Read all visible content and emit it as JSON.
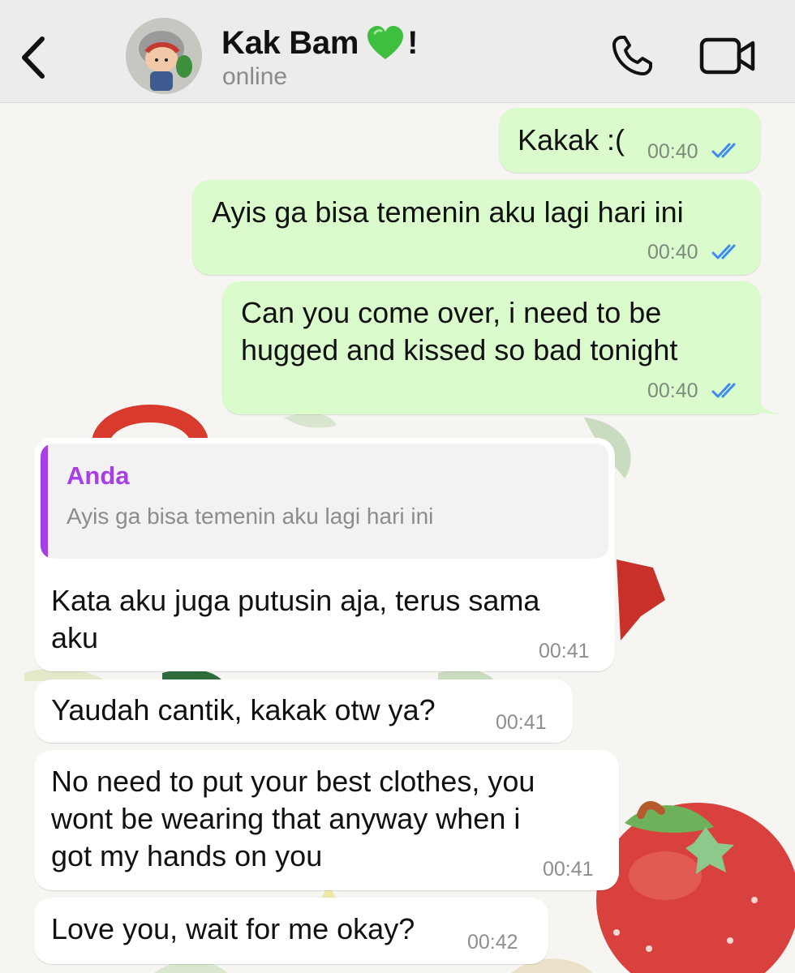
{
  "header": {
    "contact_name": "Kak Bam",
    "contact_name_suffix": "!",
    "contact_status": "online",
    "heart_icon": "green-heart-emoji",
    "back_icon": "chevron-left-icon",
    "call_icon": "phone-icon",
    "video_icon": "video-camera-icon"
  },
  "messages": [
    {
      "direction": "outgoing",
      "text": "Kakak :(",
      "time": "00:40",
      "status": "read"
    },
    {
      "direction": "outgoing",
      "text": "Ayis ga bisa temenin aku lagi hari ini",
      "time": "00:40",
      "status": "read"
    },
    {
      "direction": "outgoing",
      "text": "Can you come over, i need to be\nhugged and kissed so bad tonight",
      "time": "00:40",
      "status": "read"
    },
    {
      "direction": "incoming",
      "reply_to": {
        "sender": "Anda",
        "text": "Ayis ga bisa temenin aku lagi hari ini"
      },
      "text": "Kata aku juga putusin aja, terus sama\naku",
      "time": "00:41"
    },
    {
      "direction": "incoming",
      "text": "Yaudah cantik, kakak otw ya?",
      "time": "00:41"
    },
    {
      "direction": "incoming",
      "text": "No need to put your best clothes, you\nwont be wearing that anyway when i\ngot my hands on you",
      "time": "00:41"
    },
    {
      "direction": "incoming",
      "text": "Love you, wait for me okay?",
      "time": "00:42"
    }
  ],
  "colors": {
    "outgoing_bubble": "#dafbcc",
    "incoming_bubble": "#ffffff",
    "read_ticks": "#3d8bf2",
    "reply_accent": "#a73ee6"
  }
}
